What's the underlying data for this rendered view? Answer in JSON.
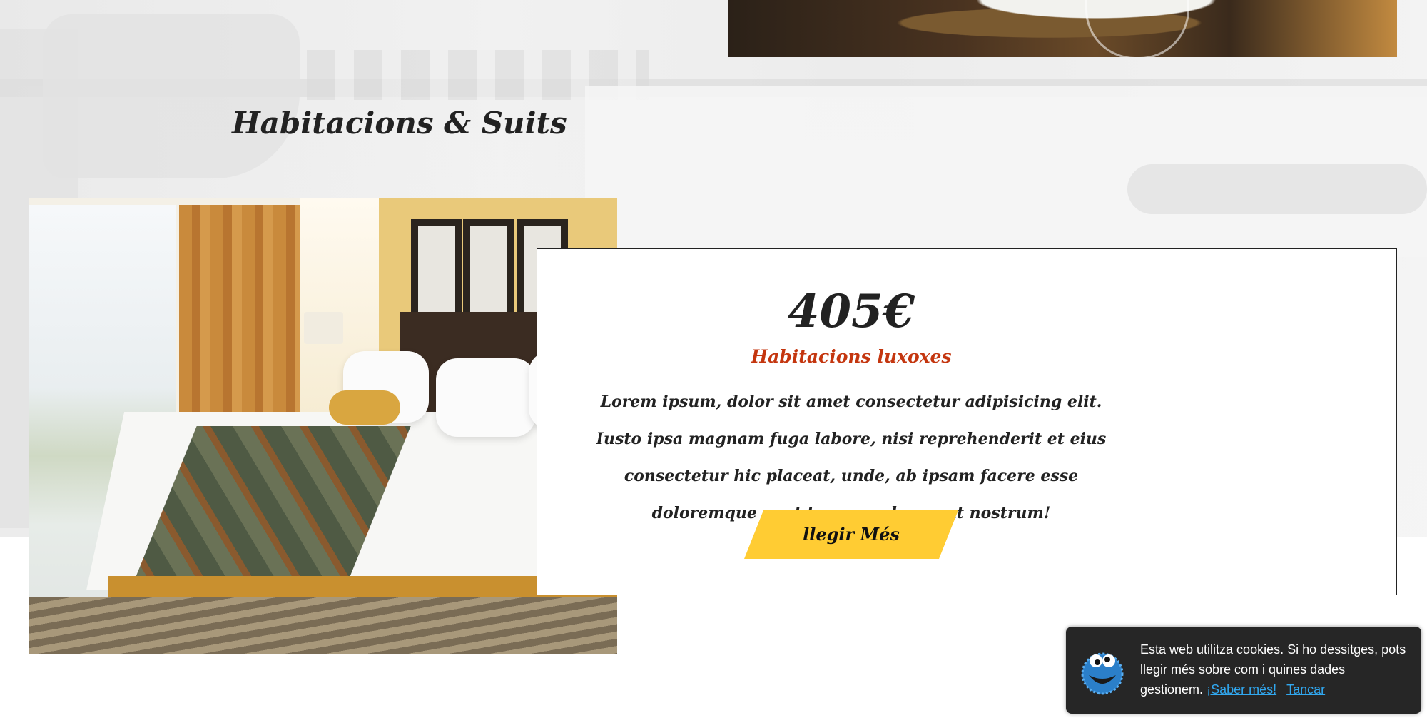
{
  "section": {
    "title": "Habitacions & Suits"
  },
  "room_card": {
    "price": "405€",
    "room_type": "Habitacions luxoxes",
    "description": "Lorem ipsum, dolor sit amet consectetur adipisicing elit. Iusto ipsa magnam fuga labore, nisi reprehenderit et eius consectetur hic placeat, unde, ab ipsam facere esse doloremque sunt tempore deserunt nostrum!",
    "button_label": "llegir Més"
  },
  "cookie_banner": {
    "icon": "cookie-monster-icon",
    "message": "Esta web utilitza cookies. Si ho dessitges, pots llegir més sobre com i quines dades gestionem.",
    "learn_more_label": "¡Saber més!",
    "close_label": "Tancar"
  },
  "colors": {
    "accent_button": "#ffcc33",
    "room_type_text": "#c4360f",
    "cookie_link": "#31a8f0",
    "cookie_background": "#262626"
  }
}
